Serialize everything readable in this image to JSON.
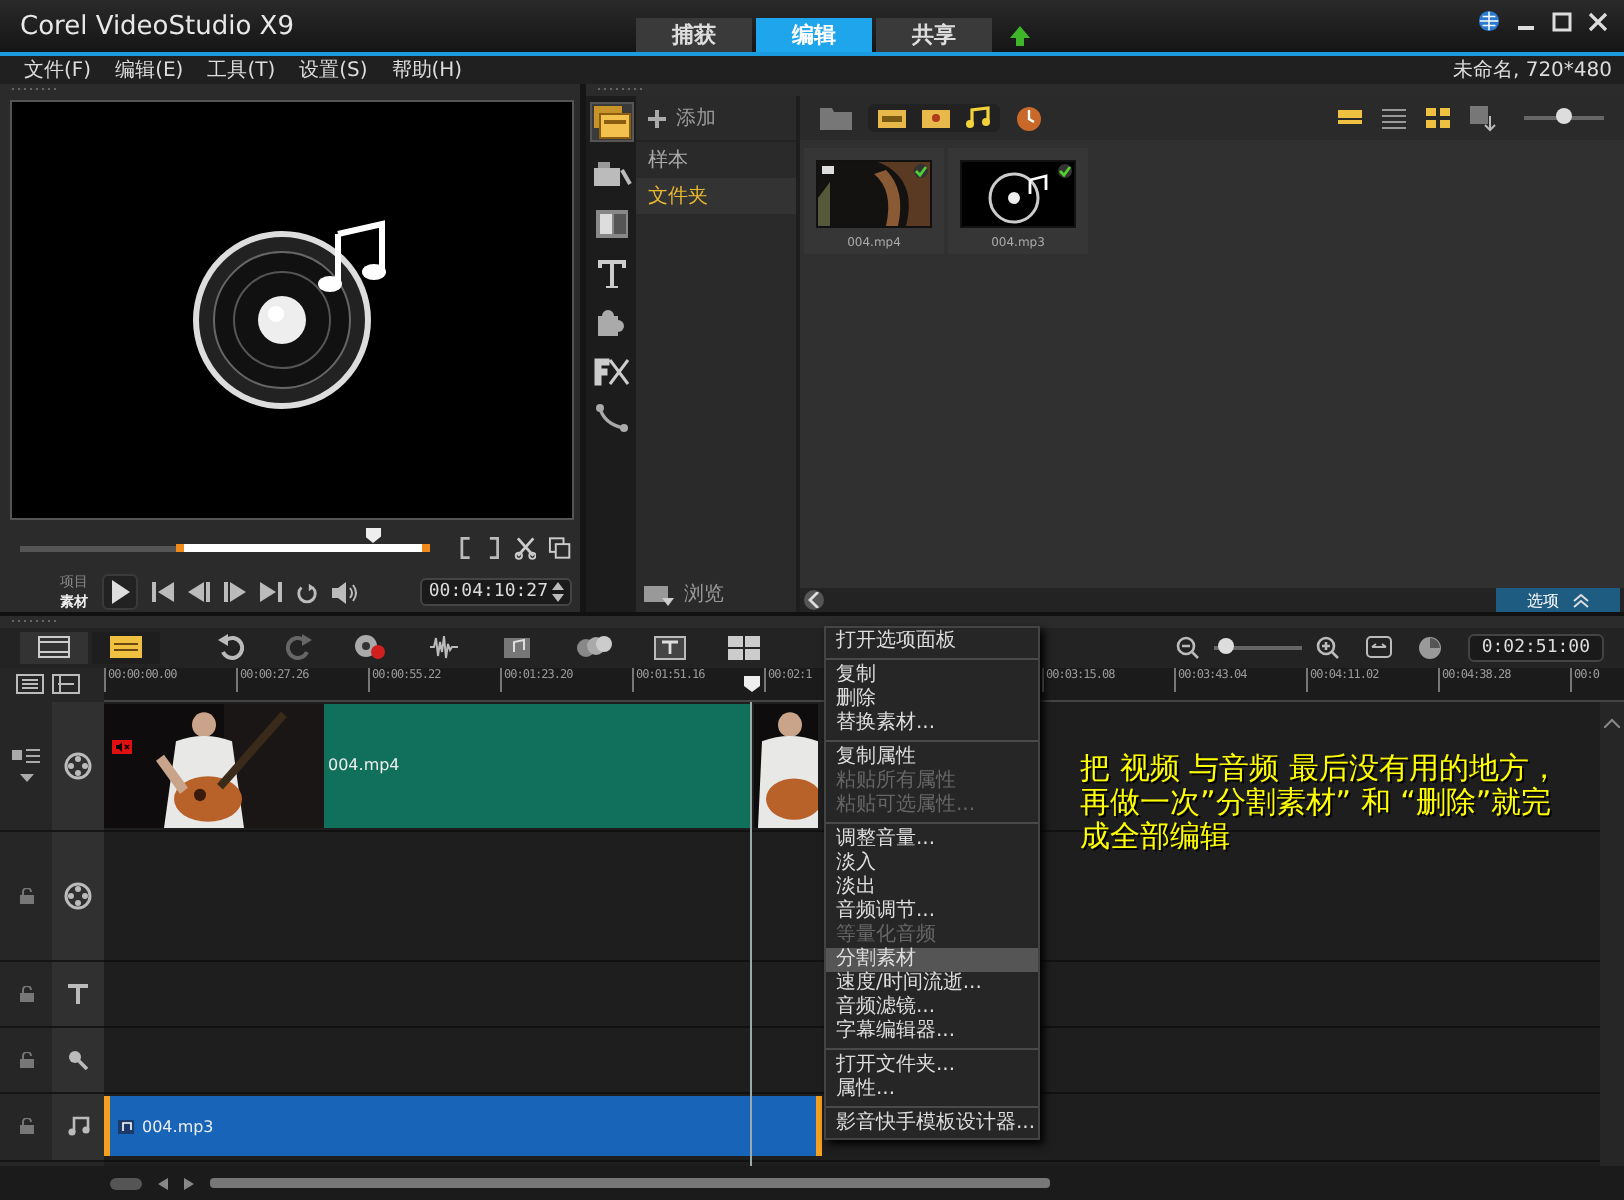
{
  "app": {
    "logo": "Corel VideoStudio X9"
  },
  "tabs": [
    {
      "label": "捕获",
      "selected": false
    },
    {
      "label": "编辑",
      "selected": true
    },
    {
      "label": "共享",
      "selected": false
    }
  ],
  "menu": [
    "文件(F)",
    "编辑(E)",
    "工具(T)",
    "设置(S)",
    "帮助(H)"
  ],
  "project_info": "未命名, 720*480",
  "player": {
    "modes": [
      {
        "label": "项目",
        "selected": false
      },
      {
        "label": "素材",
        "selected": true
      }
    ],
    "level": 0.86,
    "timecode": "00:04:10:27"
  },
  "library": {
    "add_label": "添加",
    "folders": [
      {
        "label": "样本",
        "selected": false
      },
      {
        "label": "文件夹",
        "selected": true
      }
    ],
    "browse_label": "浏览",
    "items": [
      {
        "name": "004.mp4",
        "kind": "video"
      },
      {
        "name": "004.mp3",
        "kind": "audio"
      }
    ],
    "options_label": "选项",
    "level": 0.5
  },
  "timeline": {
    "level": 0.15,
    "duration": "0:02:51:00",
    "ruler_left": [
      "00:00:00.00",
      "00:00:27.26",
      "00:00:55.22",
      "00:01:23.20",
      "00:01:51.16",
      "00:02:1"
    ],
    "ruler_right": [
      "00:03:15.08",
      "00:03:43.04",
      "00:04:11.02",
      "00:04:38.28",
      "00:0"
    ],
    "video_clip": {
      "name": "004.mp4",
      "muted": true
    },
    "audio_clip": {
      "name": "004.mp3",
      "selected": true
    }
  },
  "context_menu": [
    {
      "label": "打开选项面板",
      "disabled": false,
      "highlighted": false,
      "separator_before": false
    },
    {
      "label": "复制",
      "disabled": false,
      "highlighted": false,
      "separator_before": true
    },
    {
      "label": "删除",
      "disabled": false,
      "highlighted": false,
      "separator_before": false
    },
    {
      "label": "替换素材...",
      "disabled": false,
      "highlighted": false,
      "separator_before": false
    },
    {
      "label": "复制属性",
      "disabled": false,
      "highlighted": false,
      "separator_before": true
    },
    {
      "label": "粘贴所有属性",
      "disabled": true,
      "highlighted": false,
      "separator_before": false
    },
    {
      "label": "粘贴可选属性...",
      "disabled": true,
      "highlighted": false,
      "separator_before": false
    },
    {
      "label": "调整音量...",
      "disabled": false,
      "highlighted": false,
      "separator_before": true
    },
    {
      "label": "淡入",
      "disabled": false,
      "highlighted": false,
      "separator_before": false
    },
    {
      "label": "淡出",
      "disabled": false,
      "highlighted": false,
      "separator_before": false
    },
    {
      "label": "音频调节...",
      "disabled": false,
      "highlighted": false,
      "separator_before": false
    },
    {
      "label": "等量化音频",
      "disabled": true,
      "highlighted": false,
      "separator_before": false
    },
    {
      "label": "分割素材",
      "disabled": false,
      "highlighted": true,
      "separator_before": false
    },
    {
      "label": "速度/时间流逝...",
      "disabled": false,
      "highlighted": false,
      "separator_before": false
    },
    {
      "label": "音频滤镜...",
      "disabled": false,
      "highlighted": false,
      "separator_before": false
    },
    {
      "label": "字幕编辑器...",
      "disabled": false,
      "highlighted": false,
      "separator_before": false
    },
    {
      "label": "打开文件夹...",
      "disabled": false,
      "highlighted": false,
      "separator_before": true
    },
    {
      "label": "属性...",
      "disabled": false,
      "highlighted": false,
      "separator_before": false
    },
    {
      "label": "影音快手模板设计器...",
      "disabled": false,
      "highlighted": false,
      "separator_before": true
    }
  ],
  "annotation": "把 视频 与音频 最后没有用的地方，再做一次”分割素材” 和 “删除”就完成全部编辑"
}
